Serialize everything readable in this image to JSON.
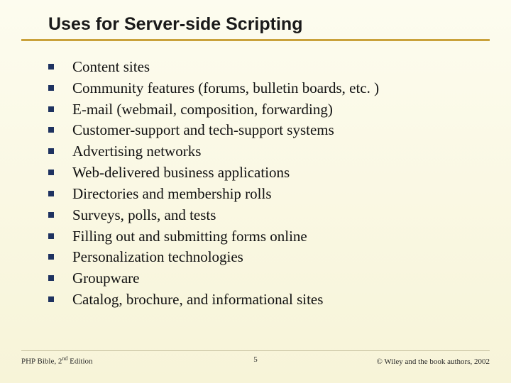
{
  "slide": {
    "title": "Uses for Server-side Scripting",
    "bullets": [
      "Content sites",
      "Community features (forums, bulletin boards, etc. )",
      "E-mail (webmail, composition, forwarding)",
      "Customer-support and tech-support systems",
      "Advertising networks",
      "Web-delivered business applications",
      "Directories and membership rolls",
      "Surveys, polls, and tests",
      "Filling out and submitting forms online",
      "Personalization technologies",
      "Groupware",
      "Catalog, brochure, and informational sites"
    ]
  },
  "footer": {
    "left_prefix": "PHP Bible, 2",
    "left_super": "nd",
    "left_suffix": " Edition",
    "page_number": "5",
    "right": "© Wiley and the book authors, 2002"
  }
}
